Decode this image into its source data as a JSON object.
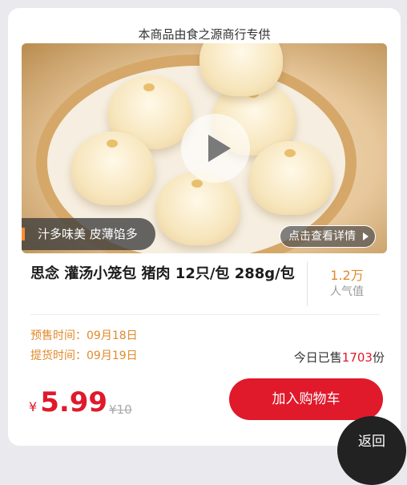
{
  "supplier_note": "本商品由食之源商行专供",
  "hero": {
    "slogan": "汁多味美 皮薄馅多",
    "detail_button": "点击查看详情",
    "play_icon": "play-icon"
  },
  "product": {
    "name": "思念 灌汤小笼包 猪肉 12只/包 288g/包",
    "popularity_value": "1.2万",
    "popularity_label": "人气值"
  },
  "schedule": {
    "presale": "预售时间：09月18日",
    "pickup": "提货时间：09月19日"
  },
  "sales": {
    "prefix": "今日已售",
    "count": "1703",
    "suffix": "份"
  },
  "price": {
    "currency": "¥",
    "current": "5.99",
    "original": "¥10"
  },
  "actions": {
    "add_to_cart": "加入购物车",
    "back": "返回"
  },
  "colors": {
    "accent_red": "#e0192b",
    "accent_orange": "#e08a2c"
  }
}
